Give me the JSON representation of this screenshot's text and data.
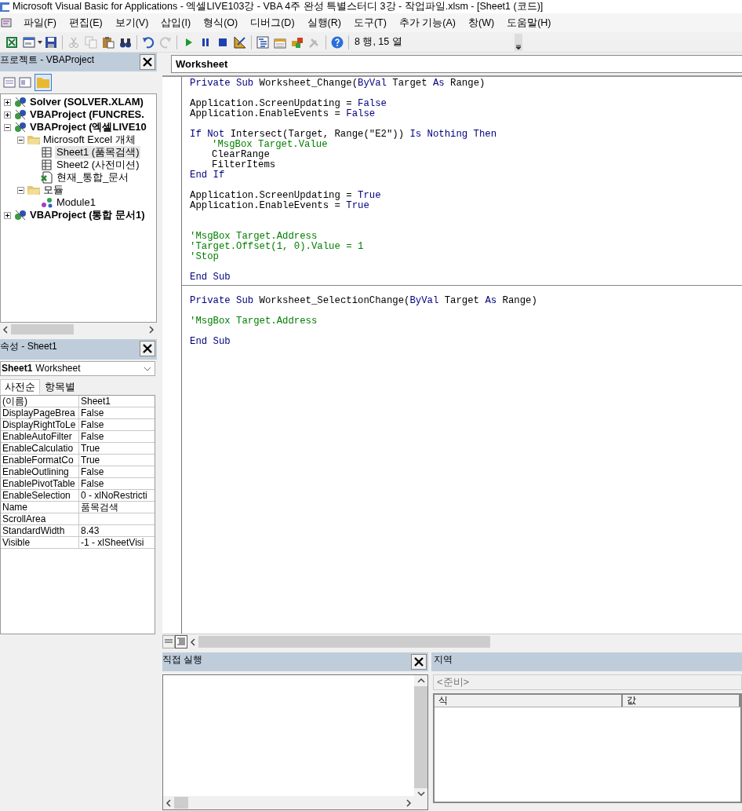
{
  "window": {
    "title": "Microsoft Visual Basic for Applications - 엑셀LIVE103강 - VBA 4주 완성 특별스터디 3강 - 작업파일.xlsm - [Sheet1 (코드)]"
  },
  "menu": [
    "파일(F)",
    "편집(E)",
    "보기(V)",
    "삽입(I)",
    "형식(O)",
    "디버그(D)",
    "실행(R)",
    "도구(T)",
    "추가 기능(A)",
    "창(W)",
    "도움말(H)"
  ],
  "toolbar": {
    "groups": [
      {
        "buttons": [
          {
            "kind": "excel",
            "disabled": false
          },
          {
            "kind": "userform",
            "disabled": false
          },
          {
            "kind": "save",
            "disabled": false
          }
        ]
      },
      {
        "buttons": [
          {
            "kind": "cut",
            "disabled": true
          },
          {
            "kind": "copy",
            "disabled": true
          },
          {
            "kind": "paste",
            "disabled": false
          },
          {
            "kind": "find",
            "disabled": false
          }
        ]
      },
      {
        "buttons": [
          {
            "kind": "undo",
            "disabled": false
          },
          {
            "kind": "redo",
            "disabled": true
          }
        ]
      },
      {
        "buttons": [
          {
            "kind": "run",
            "disabled": false
          },
          {
            "kind": "pause",
            "disabled": false
          },
          {
            "kind": "stop",
            "disabled": false
          },
          {
            "kind": "design",
            "disabled": false
          }
        ]
      },
      {
        "buttons": [
          {
            "kind": "project",
            "disabled": false
          },
          {
            "kind": "properties",
            "disabled": false
          },
          {
            "kind": "browser",
            "disabled": false
          },
          {
            "kind": "toolbox",
            "disabled": true
          }
        ]
      },
      {
        "buttons": [
          {
            "kind": "help",
            "disabled": false
          }
        ]
      }
    ],
    "position": "8 행, 15 열"
  },
  "project_explorer": {
    "title": "프로젝트 - VBAProject",
    "items": [
      {
        "label": "Solver (SOLVER.XLAM)",
        "kind": "project",
        "expanded": false,
        "selected": false
      },
      {
        "label": "VBAProject (FUNCRES.",
        "kind": "project",
        "expanded": false,
        "selected": false
      },
      {
        "label": "VBAProject (엑셀LIVE10",
        "kind": "project",
        "expanded": true,
        "selected": false,
        "children": [
          {
            "label": "Microsoft Excel 개체",
            "kind": "folder",
            "expanded": true,
            "selected": false,
            "children": [
              {
                "label": "Sheet1 (품목검색)",
                "kind": "sheet",
                "selected": true
              },
              {
                "label": "Sheet2 (사전미션)",
                "kind": "sheet",
                "selected": false
              },
              {
                "label": "현재_통합_문서",
                "kind": "workbook",
                "selected": false
              }
            ]
          },
          {
            "label": "모듈",
            "kind": "folder",
            "expanded": true,
            "selected": false,
            "children": [
              {
                "label": "Module1",
                "kind": "module",
                "selected": false
              }
            ]
          }
        ]
      },
      {
        "label": "VBAProject (통합 문서1)",
        "kind": "project",
        "expanded": false,
        "selected": false
      }
    ]
  },
  "properties": {
    "title": "속성 - Sheet1",
    "object_name": "Sheet1",
    "object_type": "Worksheet",
    "tabs": [
      {
        "label": "사전순",
        "selected": true
      },
      {
        "label": "항목별",
        "selected": false
      }
    ],
    "rows": [
      {
        "name": "(이름)",
        "value": "Sheet1"
      },
      {
        "name": "DisplayPageBrea",
        "value": "False"
      },
      {
        "name": "DisplayRightToLe",
        "value": "False"
      },
      {
        "name": "EnableAutoFilter",
        "value": "False"
      },
      {
        "name": "EnableCalculatio",
        "value": "True"
      },
      {
        "name": "EnableFormatCo",
        "value": "True"
      },
      {
        "name": "EnableOutlining",
        "value": "False"
      },
      {
        "name": "EnablePivotTable",
        "value": "False"
      },
      {
        "name": "EnableSelection",
        "value": "0 - xlNoRestricti"
      },
      {
        "name": "Name",
        "value": "품목검색"
      },
      {
        "name": "ScrollArea"
      },
      {
        "name": "StandardWidth",
        "value": "8.43"
      },
      {
        "name": "Visible",
        "value": "-1 - xlSheetVisi"
      }
    ]
  },
  "code_window": {
    "object": "Worksheet",
    "procedures": [
      {
        "lines": [
          {
            "kind": "code",
            "indented": false,
            "segments": [
              {
                "kind": "keyword",
                "text": "Private Sub"
              },
              {
                "kind": "plain",
                "text": " Worksheet_Change("
              },
              {
                "kind": "keyword",
                "text": "ByVal"
              },
              {
                "kind": "plain",
                "text": " Target "
              },
              {
                "kind": "keyword",
                "text": "As"
              },
              {
                "kind": "plain",
                "text": " Range)"
              }
            ]
          },
          {
            "kind": "blank"
          },
          {
            "kind": "code",
            "indented": false,
            "segments": [
              {
                "kind": "plain",
                "text": "Application.ScreenUpdating = "
              },
              {
                "kind": "keyword",
                "text": "False"
              }
            ]
          },
          {
            "kind": "code",
            "indented": false,
            "segments": [
              {
                "kind": "plain",
                "text": "Application.EnableEvents = "
              },
              {
                "kind": "keyword",
                "text": "False"
              }
            ]
          },
          {
            "kind": "blank"
          },
          {
            "kind": "code",
            "indented": false,
            "segments": [
              {
                "kind": "keyword",
                "text": "If Not"
              },
              {
                "kind": "plain",
                "text": " Intersect(Target, Range(\"E2\")) "
              },
              {
                "kind": "keyword",
                "text": "Is Nothing Then"
              }
            ]
          },
          {
            "kind": "code",
            "indented": true,
            "segments": [
              {
                "kind": "comment",
                "text": "'MsgBox Target.Value"
              }
            ]
          },
          {
            "kind": "code",
            "indented": true,
            "segments": [
              {
                "kind": "plain",
                "text": "ClearRange"
              }
            ]
          },
          {
            "kind": "code",
            "indented": true,
            "segments": [
              {
                "kind": "plain",
                "text": "FilterItems"
              }
            ]
          },
          {
            "kind": "code",
            "indented": false,
            "segments": [
              {
                "kind": "keyword",
                "text": "End If"
              }
            ]
          },
          {
            "kind": "blank"
          },
          {
            "kind": "code",
            "indented": false,
            "segments": [
              {
                "kind": "plain",
                "text": "Application.ScreenUpdating = "
              },
              {
                "kind": "keyword",
                "text": "True"
              }
            ]
          },
          {
            "kind": "code",
            "indented": false,
            "segments": [
              {
                "kind": "plain",
                "text": "Application.EnableEvents = "
              },
              {
                "kind": "keyword",
                "text": "True"
              }
            ]
          },
          {
            "kind": "blank"
          },
          {
            "kind": "blank"
          },
          {
            "kind": "code",
            "indented": false,
            "segments": [
              {
                "kind": "comment",
                "text": "'MsgBox Target.Address"
              }
            ]
          },
          {
            "kind": "code",
            "indented": false,
            "segments": [
              {
                "kind": "comment",
                "text": "'Target.Offset(1, 0).Value = 1"
              }
            ]
          },
          {
            "kind": "code",
            "indented": false,
            "segments": [
              {
                "kind": "comment",
                "text": "'Stop"
              }
            ]
          },
          {
            "kind": "blank"
          },
          {
            "kind": "code",
            "indented": false,
            "segments": [
              {
                "kind": "keyword",
                "text": "End Sub"
              }
            ]
          }
        ]
      },
      {
        "lines": [
          {
            "kind": "blank"
          },
          {
            "kind": "code",
            "indented": false,
            "segments": [
              {
                "kind": "keyword",
                "text": "Private Sub"
              },
              {
                "kind": "plain",
                "text": " Worksheet_SelectionChange("
              },
              {
                "kind": "keyword",
                "text": "ByVal"
              },
              {
                "kind": "plain",
                "text": " Target "
              },
              {
                "kind": "keyword",
                "text": "As"
              },
              {
                "kind": "plain",
                "text": " Range)"
              }
            ]
          },
          {
            "kind": "blank"
          },
          {
            "kind": "code",
            "indented": false,
            "segments": [
              {
                "kind": "comment",
                "text": "'MsgBox Target.Address"
              }
            ]
          },
          {
            "kind": "blank"
          },
          {
            "kind": "code",
            "indented": false,
            "segments": [
              {
                "kind": "keyword",
                "text": "End Sub"
              }
            ]
          }
        ]
      }
    ],
    "views": [
      {
        "kind": "procedure",
        "selected": false
      },
      {
        "kind": "module",
        "selected": true
      }
    ]
  },
  "immediate": {
    "title": "직접 실행"
  },
  "locals": {
    "title": "지역",
    "context": "<준비>",
    "columns": [
      "식",
      "값"
    ]
  }
}
